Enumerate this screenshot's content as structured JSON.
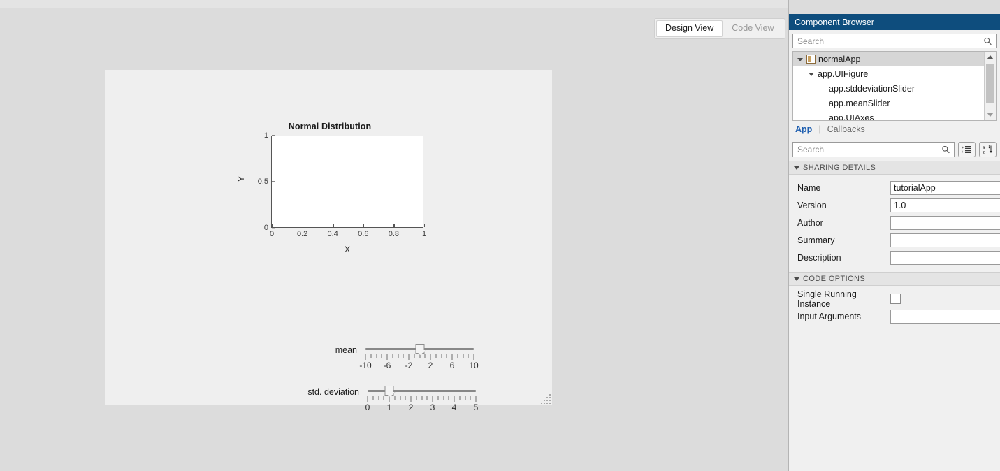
{
  "view_toggle": {
    "design_label": "Design View",
    "code_label": "Code View"
  },
  "canvas": {
    "sliders": [
      {
        "name": "mean",
        "label": "mean",
        "min": -10,
        "max": 10,
        "value": 0,
        "minor_step": 1,
        "tick_labels": [
          "-10",
          "-6",
          "-2",
          "2",
          "6",
          "10"
        ],
        "tick_values": [
          -10,
          -6,
          -2,
          2,
          6,
          10
        ]
      },
      {
        "name": "std-deviation",
        "label": "std. deviation",
        "min": 0,
        "max": 5,
        "value": 1,
        "minor_step": 0.25,
        "tick_labels": [
          "0",
          "1",
          "2",
          "3",
          "4",
          "5"
        ],
        "tick_values": [
          0,
          1,
          2,
          3,
          4,
          5
        ]
      }
    ]
  },
  "chart_data": {
    "type": "line",
    "title": "Normal Distribution",
    "xlabel": "X",
    "ylabel": "Y",
    "xlim": [
      0,
      1
    ],
    "ylim": [
      0,
      1
    ],
    "xticks": [
      0,
      0.2,
      0.4,
      0.6,
      0.8,
      1
    ],
    "xticklabels": [
      "0",
      "0.2",
      "0.4",
      "0.6",
      "0.8",
      "1"
    ],
    "yticks": [
      0,
      0.5,
      1
    ],
    "yticklabels": [
      "0",
      "0.5",
      "1"
    ],
    "grid": false,
    "legend": null,
    "series": [
      {
        "name": "normal-pdf",
        "x": [],
        "y": []
      }
    ]
  },
  "component_browser": {
    "title": "Component Browser",
    "search_placeholder": "Search",
    "search_value": "",
    "tree": [
      {
        "label": "normalApp",
        "indent": 0,
        "caret": true,
        "icon": "app-file-icon",
        "selected": true
      },
      {
        "label": "app.UIFigure",
        "indent": 1,
        "caret": true,
        "icon": null,
        "selected": false
      },
      {
        "label": "app.stddeviationSlider",
        "indent": 2,
        "caret": false,
        "icon": null,
        "selected": false
      },
      {
        "label": "app.meanSlider",
        "indent": 2,
        "caret": false,
        "icon": null,
        "selected": false
      },
      {
        "label": "app.UIAxes",
        "indent": 2,
        "caret": false,
        "icon": null,
        "selected": false
      }
    ]
  },
  "inspector": {
    "tabs": [
      {
        "label": "App",
        "active": true
      },
      {
        "label": "Callbacks",
        "active": false
      }
    ],
    "separator": "|",
    "search_placeholder": "Search",
    "search_value": "",
    "sections": [
      {
        "title": "SHARING DETAILS",
        "rows": [
          {
            "label": "Name",
            "value": "tutorialApp",
            "type": "text"
          },
          {
            "label": "Version",
            "value": "1.0",
            "type": "text"
          },
          {
            "label": "Author",
            "value": "",
            "type": "text"
          },
          {
            "label": "Summary",
            "value": "",
            "type": "text"
          },
          {
            "label": "Description",
            "value": "",
            "type": "text"
          }
        ]
      },
      {
        "title": "CODE OPTIONS",
        "rows": [
          {
            "label": "Single Running Instance",
            "value": "",
            "type": "checkbox",
            "checked": false
          },
          {
            "label": "Input Arguments",
            "value": "",
            "type": "text"
          }
        ]
      }
    ]
  },
  "colors": {
    "panel_header": "#0e4d7d",
    "workspace": "#dcdcdc",
    "canvas": "#efefef",
    "active_tab_text": "#1f5fb0"
  }
}
